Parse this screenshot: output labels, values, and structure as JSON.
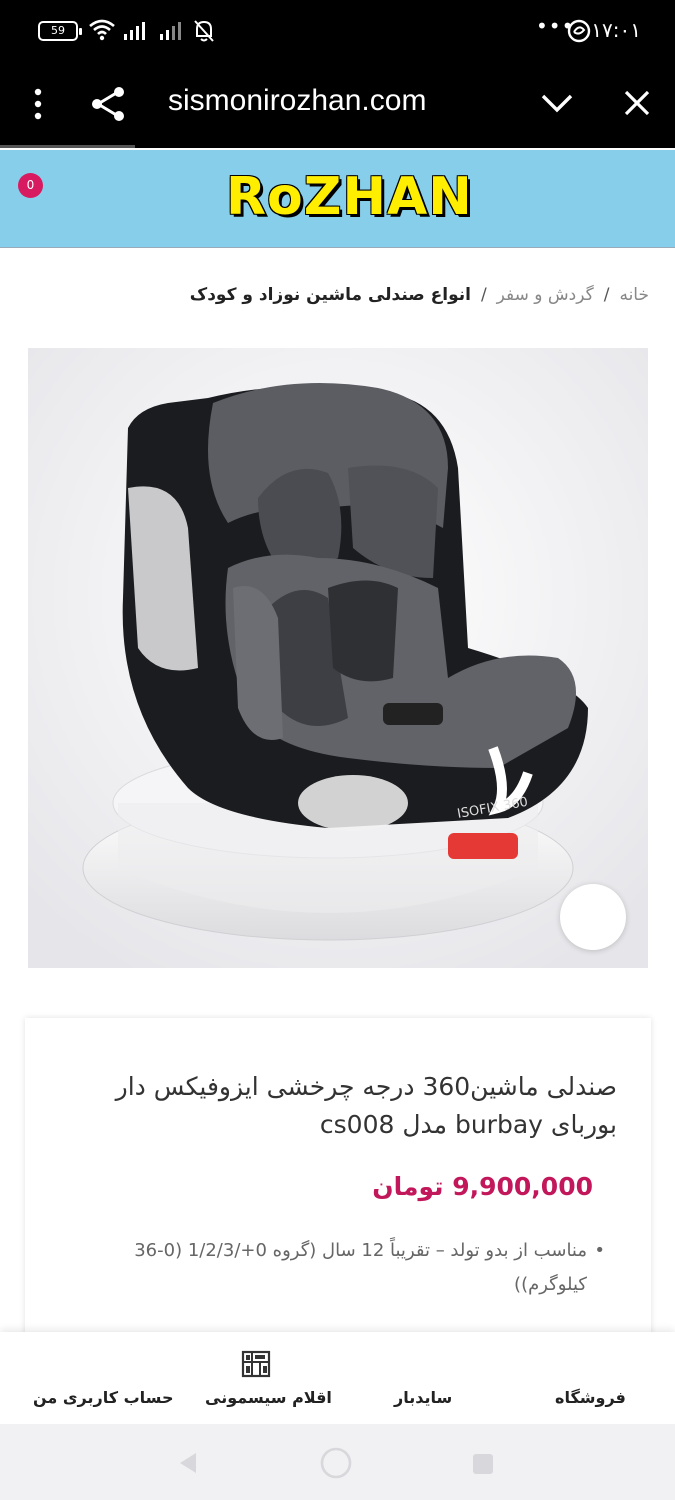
{
  "status_bar": {
    "battery": "59",
    "time": "۱۷:۰۱",
    "icons": [
      "battery-icon",
      "wifi-icon",
      "signal-icon",
      "signal-icon",
      "bell-off-icon",
      "more-dots-icon",
      "app-icon"
    ]
  },
  "browser": {
    "url": "sismonirozhan.com",
    "icons": [
      "menu-dots-icon",
      "share-icon",
      "chevron-down-icon",
      "close-icon"
    ]
  },
  "header": {
    "cart_count": "0",
    "logo_text": "RoZHAN",
    "brand_color": "#87ceeb",
    "logo_color": "#ffee00"
  },
  "breadcrumb": {
    "items": [
      "خانه",
      "گردش و سفر",
      "انواع صندلی ماشین نوزاد و کودک"
    ],
    "separator": "/"
  },
  "product": {
    "title": "صندلی ماشین360 درجه چرخشی ایزوفیکس دار بوربای burbay مدل cs008",
    "price": "9,900,000 تومان",
    "price_color": "#c2185b",
    "feature_1": "مناسب از بدو تولد – تقریباً 12 سال (گروه 0+/1/2/3 (0-36 کیلوگرم))"
  },
  "bottom_nav": {
    "items": [
      {
        "label": "حساب کاربری من"
      },
      {
        "label": "اقلام سیسمونی",
        "icon": "sismoni-items-icon"
      },
      {
        "label": "سایدبار"
      },
      {
        "label": "فروشگاه"
      }
    ]
  },
  "system_nav": {
    "icons": [
      "back-icon",
      "home-icon",
      "recents-icon"
    ]
  }
}
